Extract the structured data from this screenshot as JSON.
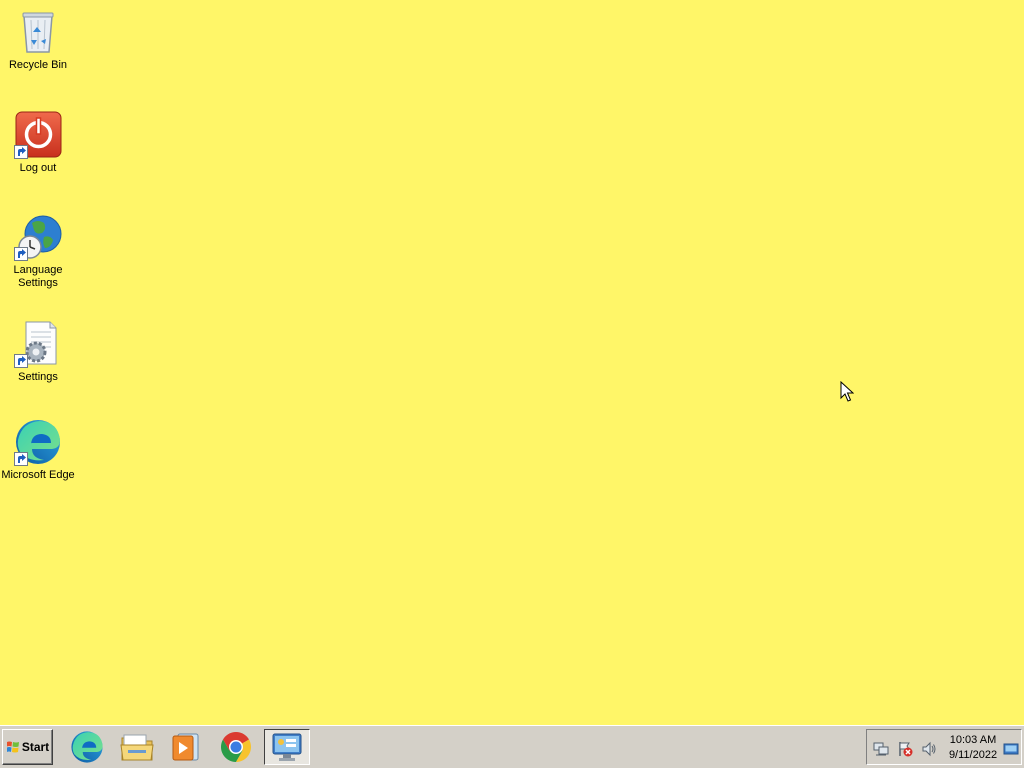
{
  "desktop": {
    "background_color": "#fff668",
    "icons": [
      {
        "label": "Recycle Bin",
        "icon": "recycle-bin-icon"
      },
      {
        "label": "Log out",
        "icon": "power-icon"
      },
      {
        "label": "Language Settings",
        "icon": "globe-clock-icon"
      },
      {
        "label": "Settings",
        "icon": "settings-document-icon"
      },
      {
        "label": "Microsoft Edge",
        "icon": "edge-icon"
      }
    ]
  },
  "taskbar": {
    "start_label": "Start",
    "pinned": [
      {
        "name": "Microsoft Edge",
        "icon": "edge-icon"
      },
      {
        "name": "File Explorer",
        "icon": "folder-icon"
      },
      {
        "name": "Media Player",
        "icon": "media-player-icon"
      },
      {
        "name": "Google Chrome",
        "icon": "chrome-icon"
      },
      {
        "name": "Control Panel",
        "icon": "control-panel-icon",
        "active": true
      }
    ],
    "tray": {
      "icons": [
        "network-icon",
        "action-center-icon",
        "volume-icon",
        "show-desktop-icon"
      ],
      "time": "10:03 AM",
      "date": "9/11/2022"
    }
  }
}
